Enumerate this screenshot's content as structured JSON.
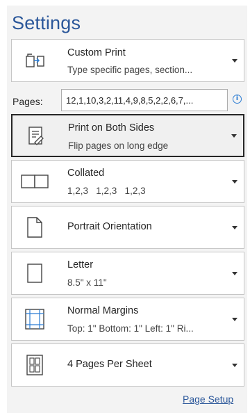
{
  "title": "Settings",
  "print_range": {
    "icon": "custom-print-icon",
    "label": "Custom Print",
    "sublabel": "Type specific pages, section..."
  },
  "pages": {
    "label": "Pages:",
    "value": "12,1,10,3,2,11,4,9,8,5,2,2,6,7,..."
  },
  "sides": {
    "icon": "duplex-print-icon",
    "label": "Print on Both Sides",
    "sublabel": "Flip pages on long edge"
  },
  "collation": {
    "icon": "collated-icon",
    "label": "Collated",
    "sublabel": "1,2,3   1,2,3   1,2,3"
  },
  "orientation": {
    "icon": "portrait-icon",
    "label": "Portrait Orientation"
  },
  "paper": {
    "icon": "paper-size-icon",
    "label": "Letter",
    "sublabel": "8.5\" x 11\""
  },
  "margins": {
    "icon": "margins-icon",
    "label": "Normal Margins",
    "sublabel": "Top: 1\" Bottom: 1\" Left: 1\" Ri..."
  },
  "per_sheet": {
    "icon": "pages-per-sheet-icon",
    "label": "4 Pages Per Sheet"
  },
  "page_setup_link": "Page Setup",
  "colors": {
    "accent": "#2b579a",
    "info": "#2b7cd3"
  }
}
